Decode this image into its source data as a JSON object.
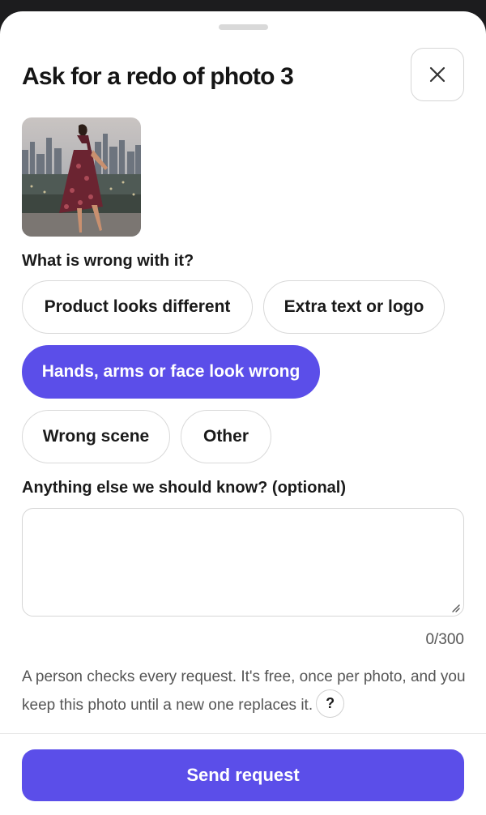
{
  "sheet": {
    "title": "Ask for a redo of photo 3"
  },
  "question": {
    "label": "What is wrong with it?",
    "options": [
      {
        "label": "Product looks different",
        "selected": false
      },
      {
        "label": "Extra text or logo",
        "selected": false
      },
      {
        "label": "Hands, arms or face look wrong",
        "selected": true
      },
      {
        "label": "Wrong scene",
        "selected": false
      },
      {
        "label": "Other",
        "selected": false
      }
    ]
  },
  "details": {
    "label": "Anything else we should know? (optional)",
    "value": "",
    "counter": "0/300"
  },
  "note": {
    "text": "A person checks every request. It's free, once per photo, and you keep this photo until a new one replaces it.",
    "help_icon": "?"
  },
  "actions": {
    "send_label": "Send request"
  },
  "colors": {
    "accent": "#5b4ee9"
  }
}
